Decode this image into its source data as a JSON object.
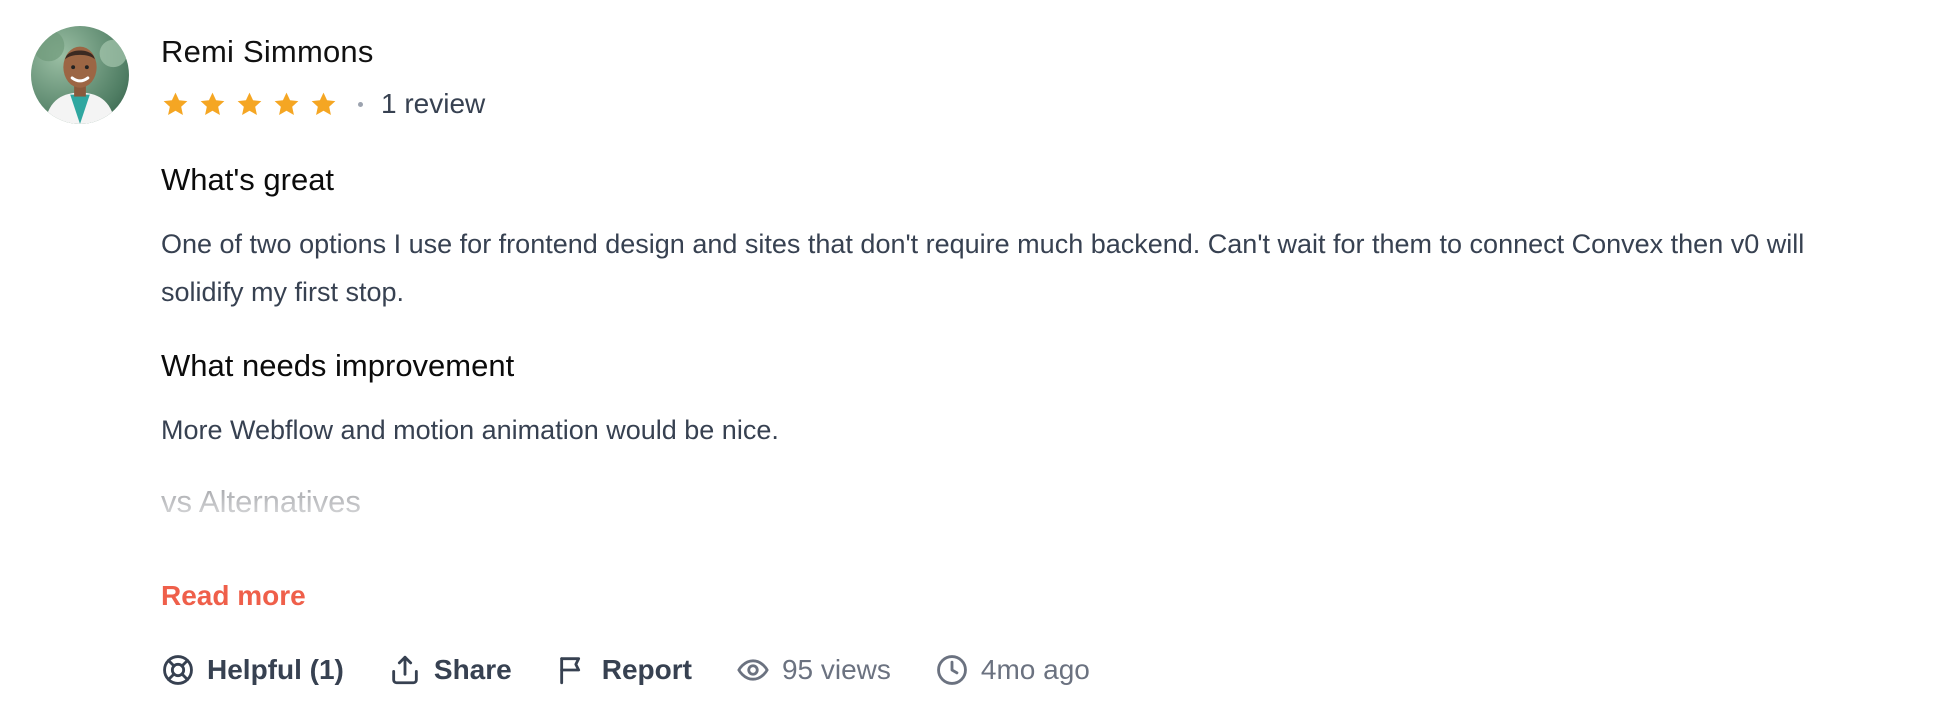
{
  "author": {
    "name": "Remi Simmons",
    "avatar_icon": "user-avatar"
  },
  "rating": {
    "stars": 5,
    "max_stars": 5,
    "star_color": "#f5a623",
    "review_count": "1 review"
  },
  "sections": {
    "great": {
      "heading": "What's great",
      "text": "One of two options I use for frontend design and sites that don't require much backend. Can't wait for them to connect Convex then v0 will solidify my first stop."
    },
    "improvement": {
      "heading": "What needs improvement",
      "text": "More Webflow and motion animation would be nice."
    },
    "alternatives": {
      "heading": "vs Alternatives"
    }
  },
  "read_more_label": "Read more",
  "accent_color": "#ef5f4a",
  "actions": {
    "helpful": {
      "label": "Helpful (1)",
      "icon": "lifebuoy-icon"
    },
    "share": {
      "label": "Share",
      "icon": "share-icon"
    },
    "report": {
      "label": "Report",
      "icon": "flag-icon"
    },
    "views": {
      "label": "95 views",
      "icon": "eye-icon"
    },
    "time": {
      "label": "4mo ago",
      "icon": "clock-icon"
    }
  }
}
